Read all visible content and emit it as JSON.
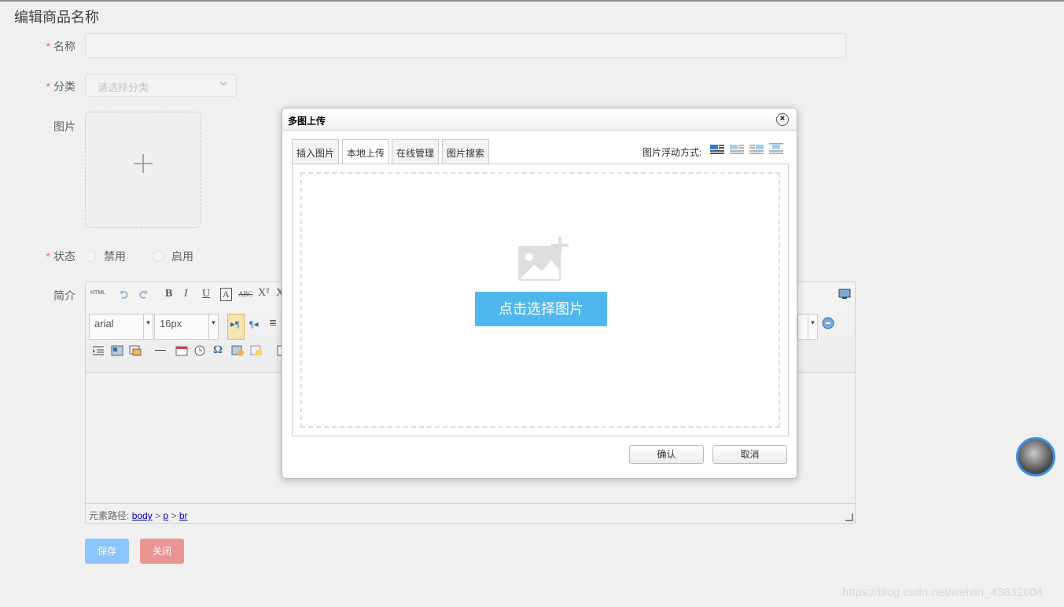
{
  "page": {
    "title": "编辑商品名称"
  },
  "form": {
    "name_label": "名称",
    "category_label": "分类",
    "category_placeholder": "请选择分类",
    "image_label": "图片",
    "status_label": "状态",
    "status_options": [
      "禁用",
      "启用"
    ],
    "intro_label": "简介",
    "required_mark": "*"
  },
  "editor": {
    "html_btn": "HTML",
    "font_family": "arial",
    "font_size": "16px",
    "status_prefix": "元素路径:",
    "path": [
      "body",
      "p",
      "br"
    ],
    "path_sep": ">"
  },
  "actions": {
    "save": "保存",
    "close": "关闭"
  },
  "dialog": {
    "title": "多图上传",
    "close": "×",
    "tabs": [
      "插入图片",
      "本地上传",
      "在线管理",
      "图片搜索"
    ],
    "active_tab": "本地上传",
    "float_label": "图片浮动方式:",
    "pick_button": "点击选择图片",
    "confirm": "确认",
    "cancel": "取消"
  },
  "watermark": "https://blog.csdn.net/weixin_43832604",
  "colors": {
    "primary_disabled": "#8cc5fb",
    "danger_disabled": "#eb9494",
    "upload_button": "#4fb7ee",
    "required": "#f56c6c"
  }
}
